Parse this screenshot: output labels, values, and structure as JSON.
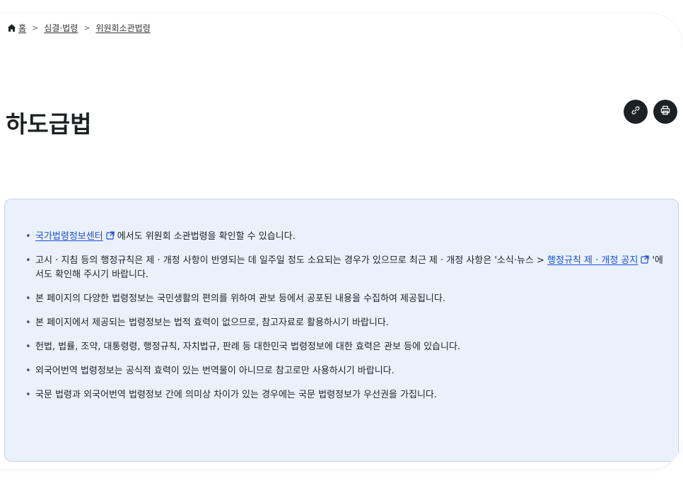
{
  "breadcrumb": {
    "home_label": "홈",
    "items": [
      "심결·법령",
      "위원회소관법령"
    ]
  },
  "title": "하도급법",
  "actions": {
    "link_icon": "link-icon",
    "print_icon": "print-icon"
  },
  "notices": {
    "item1": {
      "link": "국가법령정보센터",
      "text": "에서도 위원회 소관법령을 확인할 수 있습니다."
    },
    "item2": {
      "text_before": "고시 · 지침 등의 행정규칙은 제 · 개정 사항이 반영되는 데 일주일 정도 소요되는 경우가 있으므로 최근 제 · 개정 사항은 '소식·뉴스 > ",
      "link": "행정규칙 제 · 개정 공지",
      "text_after": "'에서도 확인해 주시기 바랍니다."
    },
    "item3": "본 페이지의 다양한 법령정보는 국민생활의 편의를 위하여 관보 등에서 공포된 내용을 수집하여 제공됩니다.",
    "item4": "본 페이지에서 제공되는 법령정보는 법적 효력이 없으므로, 참고자료로 활용하시기 바랍니다.",
    "item5": "헌법, 법률, 조약, 대통령령, 행정규칙, 자치법규, 판례 등 대한민국 법령정보에 대한 효력은 관보 등에 있습니다.",
    "item6": "외국어번역 법령정보는 공식적 효력이 있는 번역물이 아니므로 참고로만 사용하시기 바랍니다.",
    "item7": "국문 법령과 외국어번역 법령정보 간에 의미상 차이가 있는 경우에는 국문 법령정보가 우선권을 가집니다."
  },
  "colors": {
    "box_bg": "#eaf1fb",
    "link": "#1d4fd8",
    "button": "#1e2124"
  }
}
